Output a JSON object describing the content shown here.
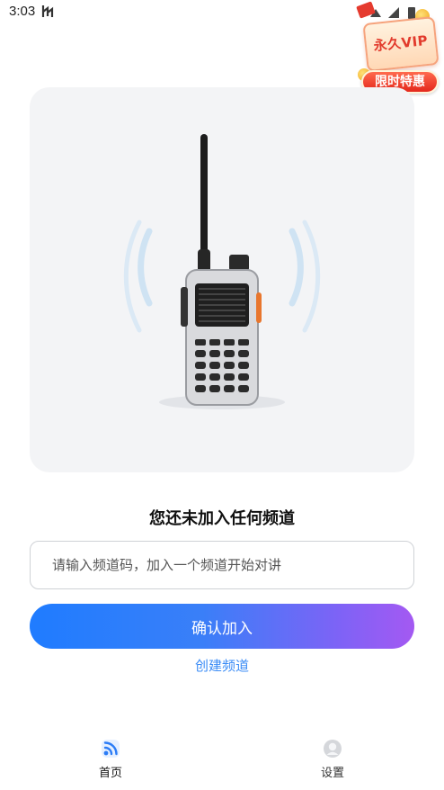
{
  "status_bar": {
    "time": "3:03"
  },
  "promo": {
    "card_text": "永久VIP",
    "ribbon_text": "限时特惠"
  },
  "hero": {
    "image": "walkie-talkie-illustration"
  },
  "main": {
    "empty_title": "您还未加入任何频道",
    "channel_input": {
      "value": "",
      "placeholder": "请输入频道码，加入一个频道开始对讲"
    },
    "confirm_label": "确认加入",
    "create_label": "创建频道"
  },
  "nav": {
    "items": [
      {
        "label": "首页",
        "icon": "radio-wave-icon",
        "active": true
      },
      {
        "label": "设置",
        "icon": "person-icon",
        "active": false
      }
    ]
  },
  "colors": {
    "accent": "#1f7cff",
    "accent_end": "#a459f2",
    "link": "#3b8cf6",
    "promo_red": "#e23a2c"
  }
}
